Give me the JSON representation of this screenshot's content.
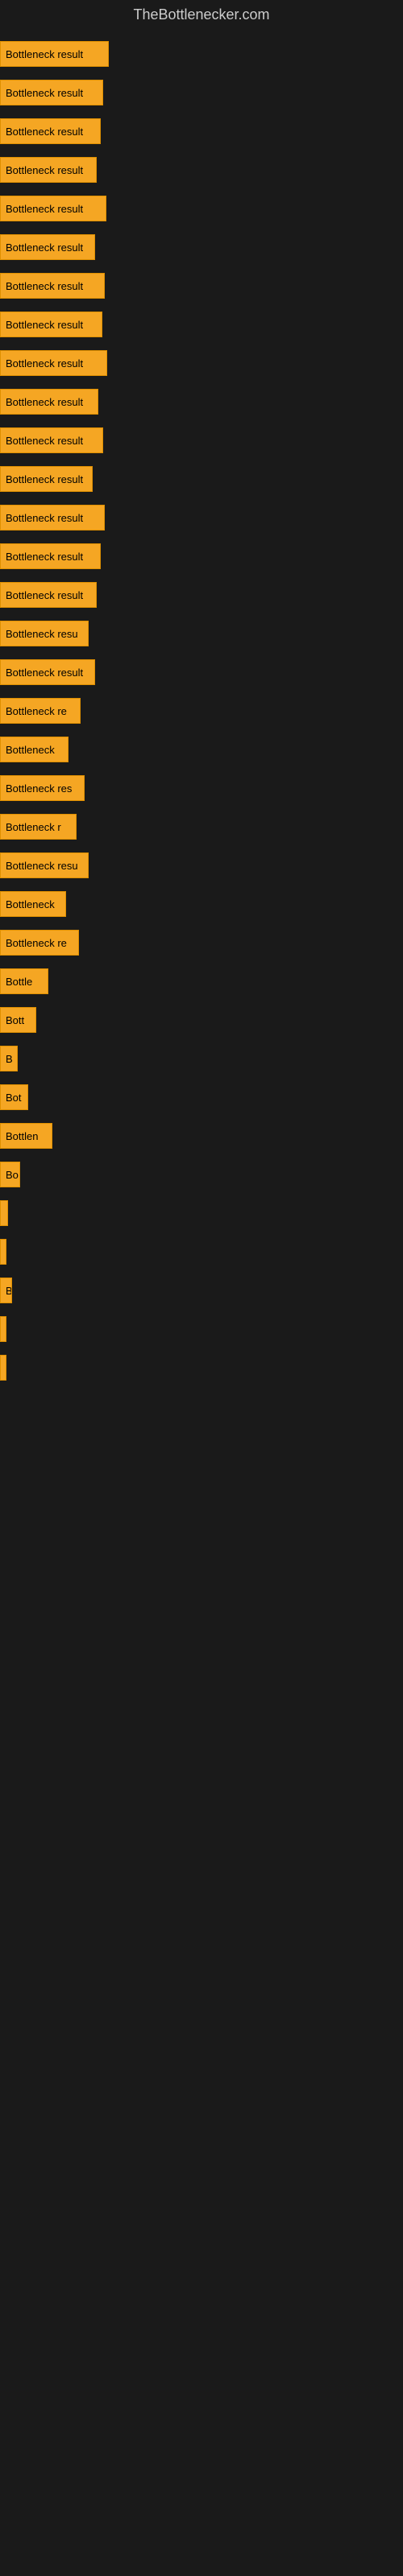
{
  "site": {
    "title": "TheBottlenecker.com"
  },
  "bars": [
    {
      "id": 1,
      "label": "Bottleneck result",
      "width": 135
    },
    {
      "id": 2,
      "label": "Bottleneck result",
      "width": 128
    },
    {
      "id": 3,
      "label": "Bottleneck result",
      "width": 125
    },
    {
      "id": 4,
      "label": "Bottleneck result",
      "width": 120
    },
    {
      "id": 5,
      "label": "Bottleneck result",
      "width": 132
    },
    {
      "id": 6,
      "label": "Bottleneck result",
      "width": 118
    },
    {
      "id": 7,
      "label": "Bottleneck result",
      "width": 130
    },
    {
      "id": 8,
      "label": "Bottleneck result",
      "width": 127
    },
    {
      "id": 9,
      "label": "Bottleneck result",
      "width": 133
    },
    {
      "id": 10,
      "label": "Bottleneck result",
      "width": 122
    },
    {
      "id": 11,
      "label": "Bottleneck result",
      "width": 128
    },
    {
      "id": 12,
      "label": "Bottleneck result",
      "width": 115
    },
    {
      "id": 13,
      "label": "Bottleneck result",
      "width": 130
    },
    {
      "id": 14,
      "label": "Bottleneck result",
      "width": 125
    },
    {
      "id": 15,
      "label": "Bottleneck result",
      "width": 120
    },
    {
      "id": 16,
      "label": "Bottleneck resu",
      "width": 110
    },
    {
      "id": 17,
      "label": "Bottleneck result",
      "width": 118
    },
    {
      "id": 18,
      "label": "Bottleneck re",
      "width": 100
    },
    {
      "id": 19,
      "label": "Bottleneck",
      "width": 85
    },
    {
      "id": 20,
      "label": "Bottleneck res",
      "width": 105
    },
    {
      "id": 21,
      "label": "Bottleneck r",
      "width": 95
    },
    {
      "id": 22,
      "label": "Bottleneck resu",
      "width": 110
    },
    {
      "id": 23,
      "label": "Bottleneck",
      "width": 82
    },
    {
      "id": 24,
      "label": "Bottleneck re",
      "width": 98
    },
    {
      "id": 25,
      "label": "Bottle",
      "width": 60
    },
    {
      "id": 26,
      "label": "Bott",
      "width": 45
    },
    {
      "id": 27,
      "label": "B",
      "width": 22
    },
    {
      "id": 28,
      "label": "Bot",
      "width": 35
    },
    {
      "id": 29,
      "label": "Bottlen",
      "width": 65
    },
    {
      "id": 30,
      "label": "Bo",
      "width": 25
    },
    {
      "id": 31,
      "label": "",
      "width": 10
    },
    {
      "id": 32,
      "label": "",
      "width": 5
    },
    {
      "id": 33,
      "label": "B",
      "width": 15
    },
    {
      "id": 34,
      "label": "",
      "width": 8
    },
    {
      "id": 35,
      "label": "",
      "width": 4
    }
  ]
}
